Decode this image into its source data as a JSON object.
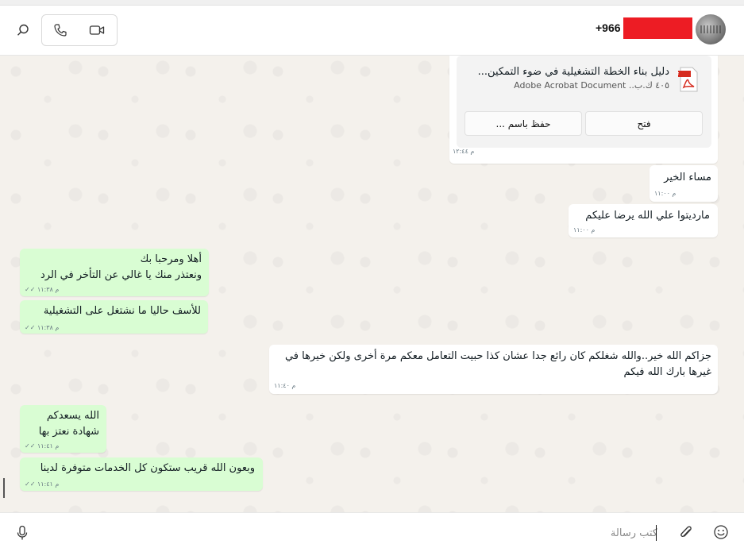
{
  "header": {
    "contact_name": "+966",
    "icons": [
      "search-icon",
      "phone-icon",
      "video-icon"
    ]
  },
  "document": {
    "title": "دليل بناء الخطة التشغيلية في ضوء التمكين...",
    "meta": "٤٠٥ ك.ب.. Adobe Acrobat Document",
    "open_label": "فتح",
    "save_as_label": "حفظ باسم ...",
    "time": "م ١٢:٤٤",
    "icon": "pdf-file-icon"
  },
  "messages": [
    {
      "dir": "in",
      "text": "مساء الخير",
      "time": "م ١١:٠٠"
    },
    {
      "dir": "in",
      "text": "مارديتوا علي الله يرضا عليكم",
      "time": "م ١١:٠٠"
    },
    {
      "dir": "out",
      "text": "أهلا ومرحبا بك\nونعتذر منك يا غالي عن التأخر في الرد",
      "time": "م ١١:٣٨",
      "ticks": "✓✓"
    },
    {
      "dir": "out",
      "text": "للأسف حاليا ما نشتغل على التشغيلية",
      "time": "م ١١:٣٨",
      "ticks": "✓✓"
    },
    {
      "dir": "in",
      "text": "جزاكم الله خير..والله شغلكم كان رائع جدا عشان كذا حبيت التعامل معكم مرة أخرى ولكن خيرها في\nغيرها بارك الله فيكم",
      "time": "م ١١:٤٠"
    },
    {
      "dir": "out",
      "text": "الله يسعدكم\nشهادة نعتز بها",
      "time": "م ١١:٤١",
      "ticks": "✓✓"
    },
    {
      "dir": "out",
      "text": "وبعون الله قريب ستكون كل الخدمات متوفرة لدينا",
      "time": "م ١١:٤١",
      "ticks": "✓✓"
    }
  ],
  "composer": {
    "placeholder": "كتب رسالة",
    "icons": [
      "mic-icon",
      "attach-icon",
      "emoji-icon"
    ]
  },
  "colors": {
    "outgoing_bubble": "#d9fdd3",
    "incoming_bubble": "#ffffff",
    "chat_background": "#f4f1ec",
    "redaction": "#ed1c24"
  }
}
